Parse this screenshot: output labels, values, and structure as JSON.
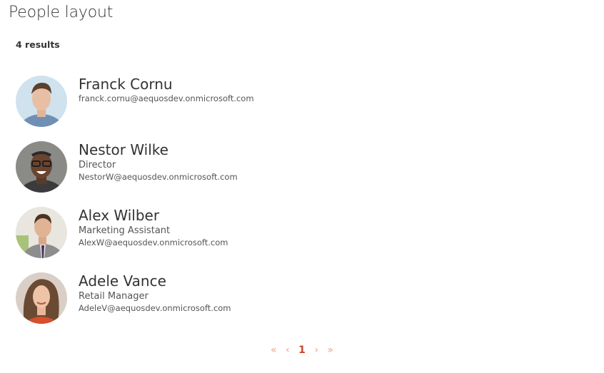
{
  "page": {
    "title": "People layout",
    "results_label": "4 results"
  },
  "people": [
    {
      "name": "Franck Cornu",
      "role": "",
      "email": "franck.cornu@aequosdev.onmicrosoft.com"
    },
    {
      "name": "Nestor Wilke",
      "role": "Director",
      "email": "NestorW@aequosdev.onmicrosoft.com"
    },
    {
      "name": "Alex Wilber",
      "role": "Marketing Assistant",
      "email": "AlexW@aequosdev.onmicrosoft.com"
    },
    {
      "name": "Adele Vance",
      "role": "Retail Manager",
      "email": "AdeleV@aequosdev.onmicrosoft.com"
    }
  ],
  "pagination": {
    "first_icon": "«",
    "prev_icon": "‹",
    "current_page": "1",
    "next_icon": "›",
    "last_icon": "»",
    "inactive_color": "#e8a48a",
    "active_color": "#c8482d"
  }
}
